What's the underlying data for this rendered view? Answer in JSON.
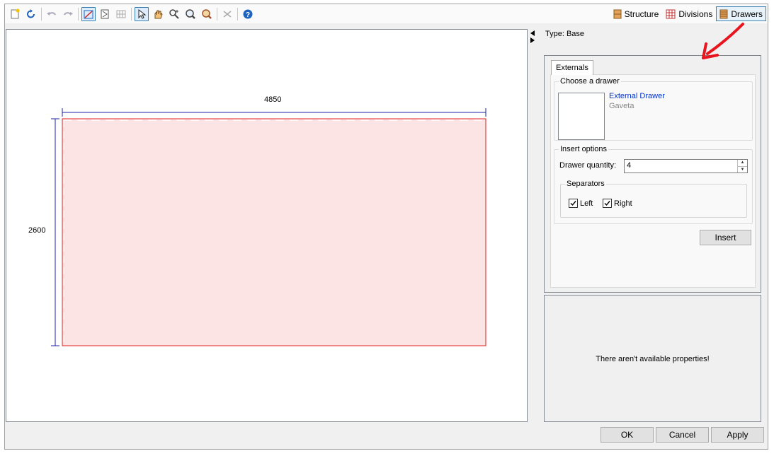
{
  "toolbar": {
    "left_icons": [
      "new-icon",
      "refresh-icon",
      "undo-icon",
      "redo-icon",
      "draw-mode-icon",
      "sheet-icon",
      "grid-icon",
      "select-icon",
      "pan-icon",
      "zoom-window-icon",
      "zoom-in-icon",
      "zoom-extents-icon",
      "delete-icon",
      "help-icon"
    ],
    "view_tabs": [
      {
        "label": "Structure",
        "icon": "structure-icon",
        "active": false
      },
      {
        "label": "Divisions",
        "icon": "divisions-icon",
        "active": false
      },
      {
        "label": "Drawers",
        "icon": "drawers-icon",
        "active": true
      }
    ]
  },
  "canvas": {
    "width_dim": "4850",
    "height_dim": "2600",
    "fill_color": "#fde4e4",
    "outline_color": "#e02020",
    "dim_color": "#1f1fa8"
  },
  "type_label": "Type: Base",
  "drawer_panel": {
    "tab_label": "Externals",
    "choose_group_title": "Choose a drawer",
    "drawer_name": "External Drawer",
    "drawer_subtitle": "Gaveta",
    "insert_group_title": "Insert options",
    "quantity_label": "Drawer quantity:",
    "quantity_value": "4",
    "separators_title": "Separators",
    "left_label": "Left",
    "right_label": "Right",
    "left_checked": true,
    "right_checked": true,
    "insert_button": "Insert"
  },
  "properties_panel": {
    "empty_message": "There aren't available properties!"
  },
  "footer": {
    "ok": "OK",
    "cancel": "Cancel",
    "apply": "Apply"
  }
}
